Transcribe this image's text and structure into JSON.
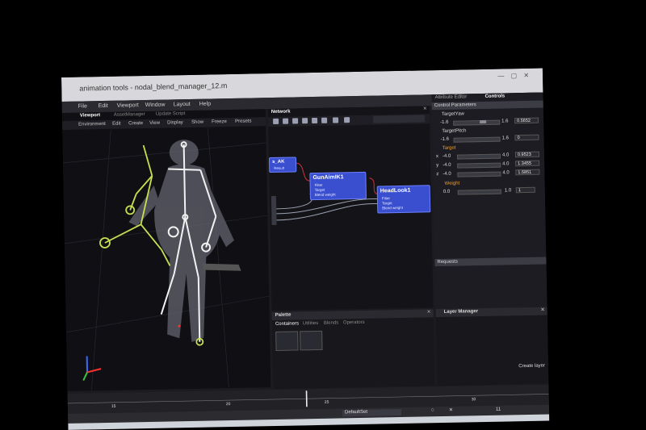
{
  "window": {
    "title": "animation tools - nodal_blend_manager_12.m"
  },
  "menubar": {
    "items": [
      "File",
      "Edit",
      "Viewport",
      "Window",
      "Layout",
      "Help"
    ]
  },
  "viewport": {
    "tabs": [
      "Viewport",
      "AssetManager",
      "Update Script"
    ],
    "toolbar": [
      "Environment",
      "Edit",
      "Create",
      "View",
      "Display",
      "Show",
      "Freeze",
      "Presets"
    ]
  },
  "network": {
    "title": "Network",
    "nodes": {
      "ak": {
        "title": "s_AK",
        "ports": [
          "Result"
        ]
      },
      "gunaim": {
        "title": "GunAimIK1",
        "ports": [
          "Filter",
          "Target",
          "Blend weight"
        ]
      },
      "headlook": {
        "title": "HeadLook1",
        "ports": [
          "Filter",
          "Target",
          "Blend weight"
        ]
      }
    }
  },
  "attr": {
    "tabs": [
      "Attribute Editor",
      "Controls"
    ],
    "section": "Control Parameters",
    "target_yaw": {
      "label": "TargetYaw",
      "min": "-1.6",
      "max": "1.6",
      "value": "0.5652"
    },
    "target_pitch": {
      "label": "TargetPitch",
      "min": "-1.6",
      "max": "1.6",
      "value": "0"
    },
    "target": {
      "label": "Target",
      "x": {
        "axis": "x",
        "min": "-4.0",
        "max": "4.0",
        "value": "0.9523"
      },
      "y": {
        "axis": "y",
        "min": "-4.0",
        "max": "4.0",
        "value": "1.3455"
      },
      "z": {
        "axis": "z",
        "min": "-4.0",
        "max": "4.0",
        "value": "1.5851"
      }
    },
    "weight": {
      "label": "Weight",
      "min": "0.0",
      "max": "1.0",
      "value": "1"
    },
    "requests": "Requests"
  },
  "palette": {
    "title": "Palette",
    "tabs": [
      "Containers",
      "Utilities",
      "Blends",
      "Operators"
    ]
  },
  "layer_manager": {
    "title": "Layer Manager",
    "create_layer": "Create layer"
  },
  "timeline": {
    "ticks": [
      "15",
      "20",
      "25",
      "30"
    ]
  },
  "status": {
    "defaultset": "DefaultSet",
    "frame": "11"
  },
  "colors": {
    "node": "#3a4fd0",
    "accent": "#f0a030",
    "bone": "#c8e050"
  }
}
